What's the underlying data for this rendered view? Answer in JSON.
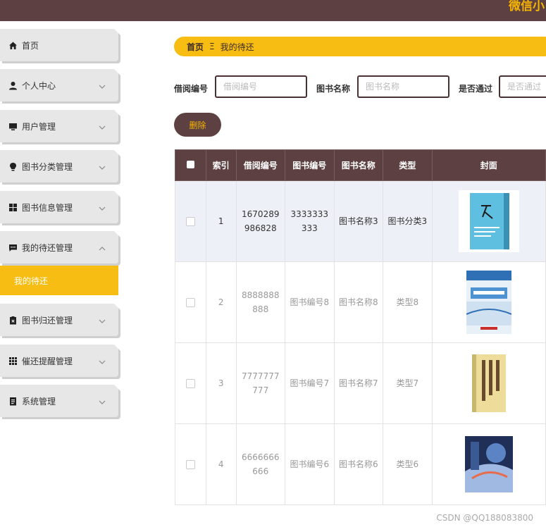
{
  "app": {
    "title": "微信小"
  },
  "sidebar": {
    "items": [
      {
        "label": "首页",
        "icon": "home-icon",
        "has_chevron": false
      },
      {
        "label": "个人中心",
        "icon": "user-icon",
        "has_chevron": true
      },
      {
        "label": "用户管理",
        "icon": "monitor-icon",
        "has_chevron": true
      },
      {
        "label": "图书分类管理",
        "icon": "bulb-icon",
        "has_chevron": true
      },
      {
        "label": "图书信息管理",
        "icon": "grid-icon",
        "has_chevron": true
      },
      {
        "label": "我的待还管理",
        "icon": "chat-icon",
        "has_chevron": true,
        "expanded": true
      },
      {
        "label": "图书归还管理",
        "icon": "clipboard-x-icon",
        "has_chevron": true
      },
      {
        "label": "催还提醒管理",
        "icon": "apps-icon",
        "has_chevron": true
      },
      {
        "label": "系统管理",
        "icon": "document-icon",
        "has_chevron": true
      }
    ],
    "sub_active": "我的待还"
  },
  "breadcrumb": {
    "home": "首页",
    "separator": "Ξ",
    "current": "我的待还"
  },
  "filters": [
    {
      "label": "借阅编号",
      "placeholder": "借阅编号"
    },
    {
      "label": "图书名称",
      "placeholder": "图书名称"
    },
    {
      "label": "是否通过",
      "placeholder": "是否通过"
    }
  ],
  "actions": {
    "delete": "删除"
  },
  "table": {
    "headers": [
      "",
      "索引",
      "借阅编号",
      "图书编号",
      "图书名称",
      "类型",
      "封面"
    ],
    "rows": [
      {
        "index": "1",
        "borrow_no": "1670289986828",
        "book_no": "3333333333",
        "book_name": "图书名称3",
        "type": "图书分类3",
        "cover": "cover-wen"
      },
      {
        "index": "2",
        "borrow_no": "8888888888",
        "book_no": "图书编号8",
        "book_name": "图书名称8",
        "type": "类型8",
        "cover": "cover-math"
      },
      {
        "index": "3",
        "borrow_no": "7777777777",
        "book_no": "图书编号7",
        "book_name": "图书名称7",
        "type": "类型7",
        "cover": "cover-classic"
      },
      {
        "index": "4",
        "borrow_no": "6666666666",
        "book_no": "图书编号6",
        "book_name": "图书名称6",
        "type": "类型6",
        "cover": "cover-scifi"
      }
    ]
  },
  "watermark": "CSDN @QQ188083800",
  "colors": {
    "brown": "#5d4041",
    "yellow": "#f8bd12",
    "gray": "#e7e7e7"
  }
}
